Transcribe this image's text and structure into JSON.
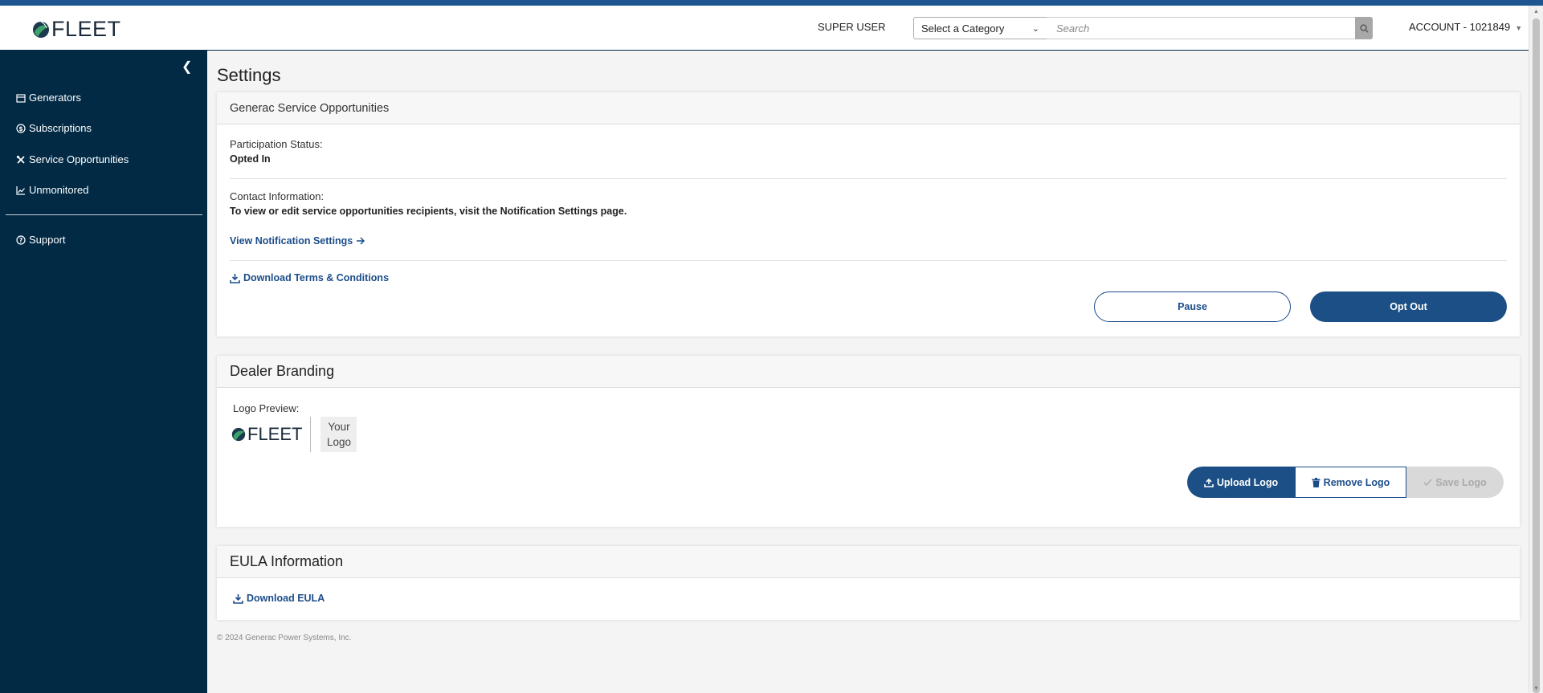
{
  "header": {
    "logo_text": "FLEET",
    "user_role": "SUPER USER",
    "category_select": "Select a Category",
    "search_placeholder": "Search",
    "account": "ACCOUNT - 1021849"
  },
  "sidebar": {
    "items": [
      {
        "label": "Generators",
        "icon": "calendar-icon"
      },
      {
        "label": "Subscriptions",
        "icon": "dollar-circle-icon"
      },
      {
        "label": "Service Opportunities",
        "icon": "tools-icon"
      },
      {
        "label": "Unmonitored",
        "icon": "chart-line-icon"
      }
    ],
    "support": {
      "label": "Support",
      "icon": "question-circle-icon"
    }
  },
  "page": {
    "title": "Settings"
  },
  "service_card": {
    "title": "Generac Service Opportunities",
    "participation_label": "Participation Status:",
    "participation_value": "Opted In",
    "contact_label": "Contact Information:",
    "contact_text": "To view or edit service opportunities recipients, visit the Notification Settings page.",
    "notification_link": "View Notification Settings",
    "download_terms": "Download Terms & Conditions",
    "pause_button": "Pause",
    "optout_button": "Opt Out"
  },
  "branding_card": {
    "title": "Dealer Branding",
    "logo_preview_label": "Logo Preview:",
    "preview_logo_text": "FLEET",
    "your_logo": "Your Logo",
    "upload_button": "Upload Logo",
    "remove_button": "Remove Logo",
    "save_button": "Save Logo"
  },
  "eula_card": {
    "title": "EULA Information",
    "download_eula": "Download EULA"
  },
  "footer": {
    "copyright": "© 2024 Generac Power Systems, Inc."
  },
  "colors": {
    "primary": "#1b4f85",
    "sidebar": "#022a45",
    "top_stripe": "#1c5590"
  }
}
